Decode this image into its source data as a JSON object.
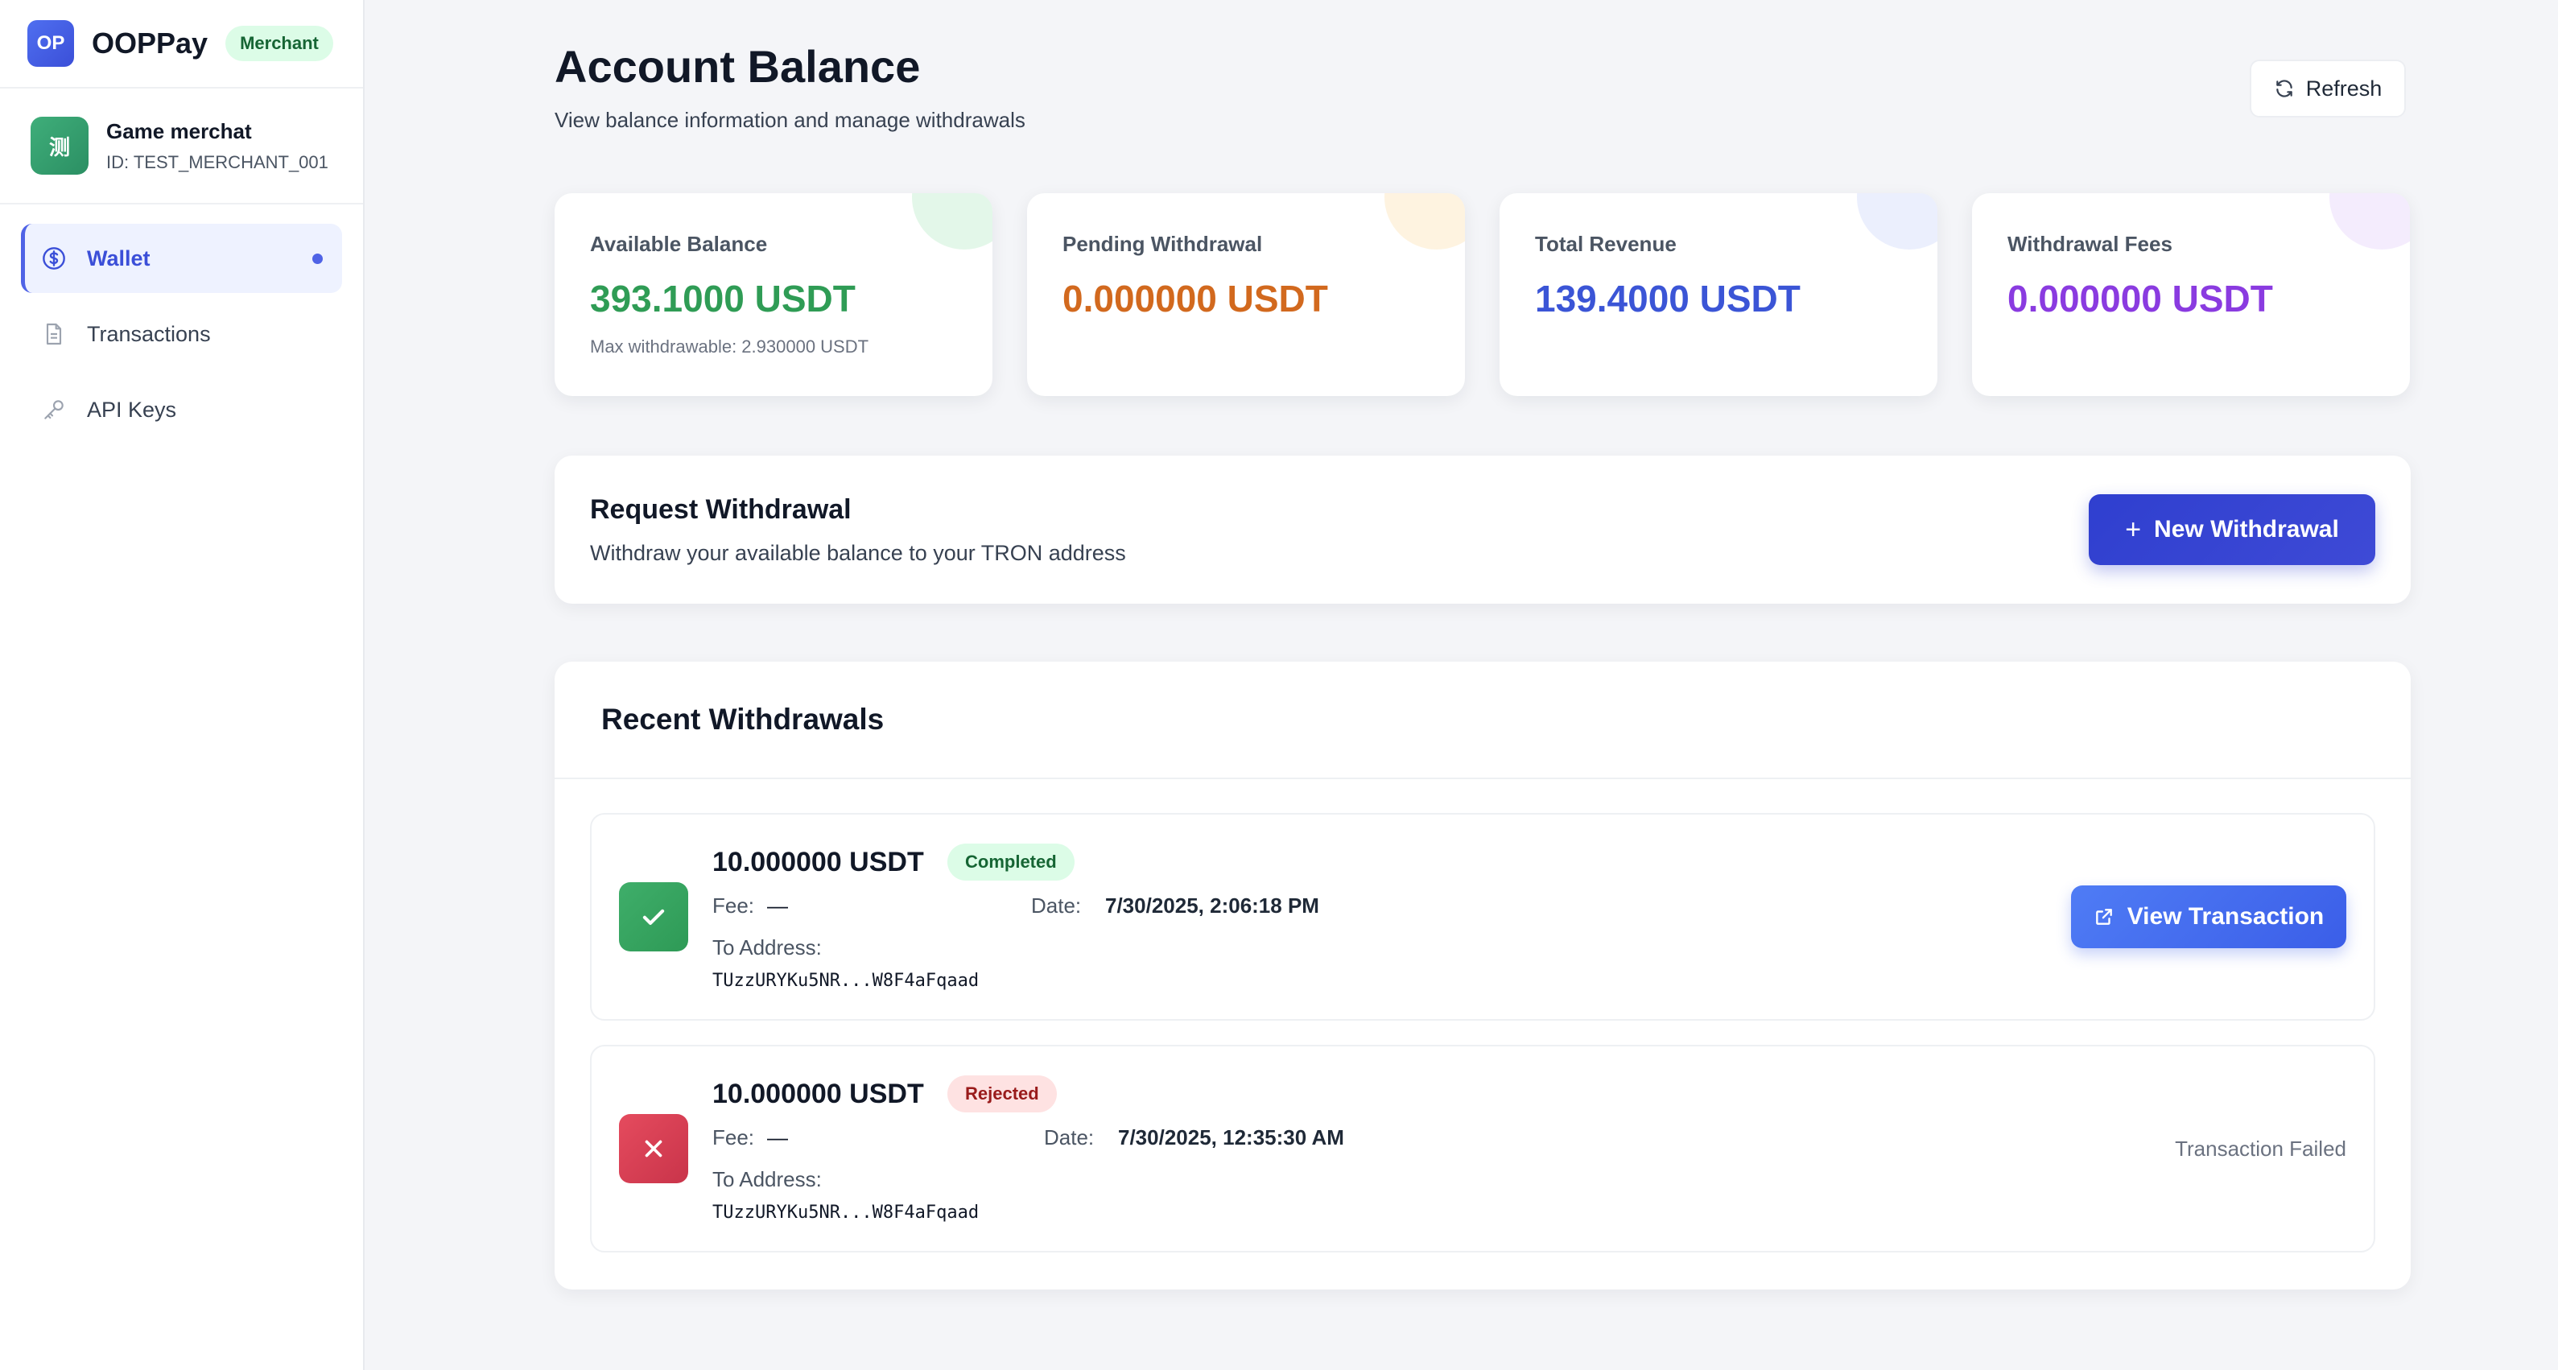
{
  "brand": {
    "logo": "OP",
    "name": "OOPPay",
    "badge": "Merchant"
  },
  "merchant": {
    "avatar": "测",
    "name": "Game merchat",
    "id": "ID: TEST_MERCHANT_001"
  },
  "nav": {
    "items": [
      {
        "label": "Wallet",
        "icon": "dollar-circle-icon",
        "active": true
      },
      {
        "label": "Transactions",
        "icon": "document-icon",
        "active": false
      },
      {
        "label": "API Keys",
        "icon": "key-icon",
        "active": false
      }
    ]
  },
  "header": {
    "title": "Account Balance",
    "subtitle": "View balance information and manage withdrawals",
    "refresh_label": "Refresh"
  },
  "cards": [
    {
      "label": "Available Balance",
      "value": "393.1000 USDT",
      "note": "Max withdrawable: 2.930000 USDT",
      "color": "#2f9c55"
    },
    {
      "label": "Pending Withdrawal",
      "value": "0.000000 USDT",
      "color": "#d2691e"
    },
    {
      "label": "Total Revenue",
      "value": "139.4000 USDT",
      "color": "#3b55d6"
    },
    {
      "label": "Withdrawal Fees",
      "value": "0.000000 USDT",
      "color": "#8a3be0"
    }
  ],
  "request": {
    "title": "Request Withdrawal",
    "subtitle": "Withdraw your available balance to your TRON address",
    "button_label": "New Withdrawal"
  },
  "recent": {
    "title": "Recent Withdrawals",
    "fee_label": "Fee:",
    "date_label": "Date:",
    "address_label": "To Address:",
    "rows": [
      {
        "amount": "10.000000 USDT",
        "status": "Completed",
        "fee": "—",
        "date": "7/30/2025, 2:06:18 PM",
        "address": "TUzzURYKu5NR...W8F4aFqaad",
        "action_label": "View Transaction"
      },
      {
        "amount": "10.000000 USDT",
        "status": "Rejected",
        "fee": "—",
        "date": "7/30/2025, 12:35:30 AM",
        "address": "TUzzURYKu5NR...W8F4aFqaad",
        "failed_label": "Transaction Failed"
      }
    ]
  },
  "colors": {
    "accent": "#3b4fd8",
    "success": "#2f9c55",
    "danger": "#d9404f"
  }
}
